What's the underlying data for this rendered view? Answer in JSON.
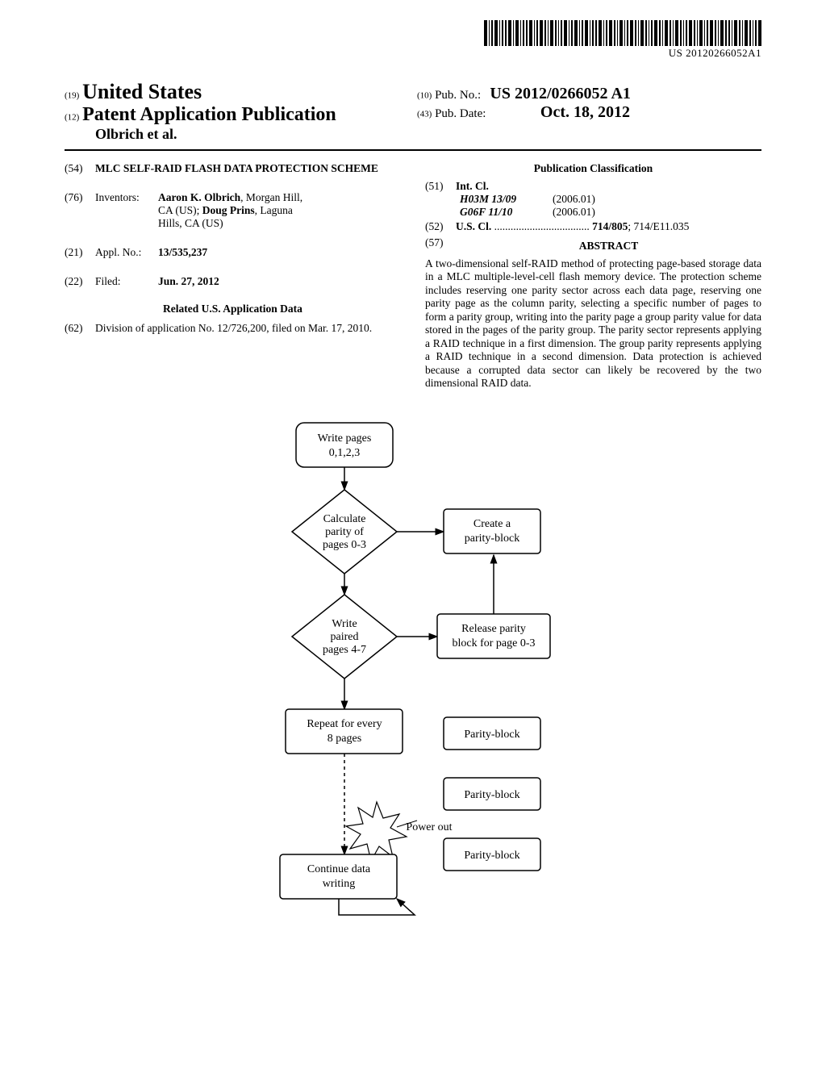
{
  "barcode_text": "US 20120266052A1",
  "header": {
    "code19": "(19)",
    "country": "United States",
    "code12": "(12)",
    "pubtype": "Patent Application Publication",
    "authors": "Olbrich et al.",
    "code10": "(10)",
    "pubno_label": "Pub. No.:",
    "pubno": "US 2012/0266052 A1",
    "code43": "(43)",
    "pubdate_label": "Pub. Date:",
    "pubdate": "Oct. 18, 2012"
  },
  "biblio": {
    "title": {
      "code": "(54)",
      "text": "MLC SELF-RAID FLASH DATA PROTECTION SCHEME"
    },
    "inventors": {
      "code": "(76)",
      "label": "Inventors:",
      "line1a": "Aaron K. Olbrich",
      "line1b": ", Morgan Hill,",
      "line2a": "CA (US); ",
      "line2b": "Doug Prins",
      "line2c": ", Laguna",
      "line3": "Hills, CA (US)"
    },
    "applno": {
      "code": "(21)",
      "label": "Appl. No.:",
      "value": "13/535,237"
    },
    "filed": {
      "code": "(22)",
      "label": "Filed:",
      "value": "Jun. 27, 2012"
    },
    "related_head": "Related U.S. Application Data",
    "division": {
      "code": "(62)",
      "text": "Division of application No. 12/726,200, filed on Mar. 17, 2010."
    },
    "classif_head": "Publication Classification",
    "intcl": {
      "code": "(51)",
      "label": "Int. Cl.",
      "rows": [
        {
          "code": "H03M 13/09",
          "year": "(2006.01)"
        },
        {
          "code": "G06F 11/10",
          "year": "(2006.01)"
        }
      ]
    },
    "uscl": {
      "code": "(52)",
      "label": "U.S. Cl.",
      "dots": " ................................... ",
      "strong": "714/805",
      "rest": "; 714/E11.035"
    },
    "abstract": {
      "code": "(57)",
      "head": "ABSTRACT",
      "body": "A two-dimensional self-RAID method of protecting page-based storage data in a MLC multiple-level-cell flash memory device. The protection scheme includes reserving one parity sector across each data page, reserving one parity page as the column parity, selecting a specific number of pages to form a parity group, writing into the parity page a group parity value for data stored in the pages of the parity group. The parity sector represents applying a RAID technique in a first dimension. The group parity represents applying a RAID technique in a second dimension. Data protection is achieved because a corrupted data sector can likely be recovered by the two dimensional RAID data."
    }
  },
  "flow": {
    "n1": {
      "l1": "Write pages",
      "l2": "0,1,2,3"
    },
    "n2": {
      "l1": "Calculate",
      "l2": "parity of",
      "l3": "pages 0-3"
    },
    "n3": {
      "l1": "Create a",
      "l2": "parity-block"
    },
    "n4": {
      "l1": "Write",
      "l2": "paired",
      "l3": "pages 4-7"
    },
    "n5": {
      "l1": "Release parity",
      "l2": "block for page 0-3"
    },
    "n6": {
      "l1": "Repeat for every",
      "l2": "8 pages"
    },
    "n7": "Parity-block",
    "n8": "Parity-block",
    "n9": "Parity-block",
    "power": "Power out",
    "n10": {
      "l1": "Continue data",
      "l2": "writing"
    }
  }
}
